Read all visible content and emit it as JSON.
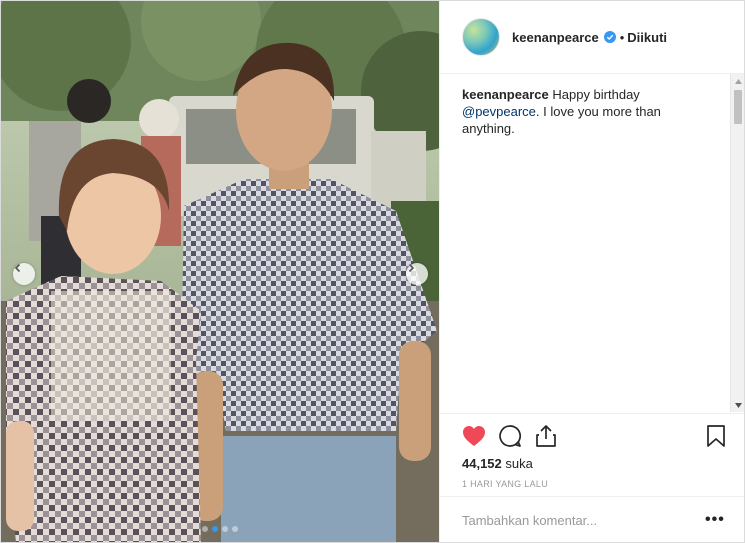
{
  "post": {
    "username": "keenanpearce",
    "separator": "•",
    "follow_label": "Diikuti",
    "caption_username": "keenanpearce",
    "caption_text_1": "Happy birthday",
    "caption_mention": "@pevpearce",
    "caption_text_2": ". I love you more than anything.",
    "likes_count": "44,152",
    "likes_label": "suka",
    "time_ago": "1 HARI YANG LALU",
    "comment_placeholder": "Tambahkan komentar...",
    "more_label": "•••"
  },
  "carousel": {
    "slide_count": 4,
    "active_slide": 1
  },
  "colors": {
    "like_red": "#ed4956",
    "verified_blue": "#3897f0",
    "mention_blue": "#003569",
    "meta_gray": "#999999"
  },
  "icons": [
    "chevron-left-icon",
    "chevron-right-icon",
    "verified-icon",
    "heart-icon",
    "comment-icon",
    "share-icon",
    "bookmark-icon"
  ]
}
